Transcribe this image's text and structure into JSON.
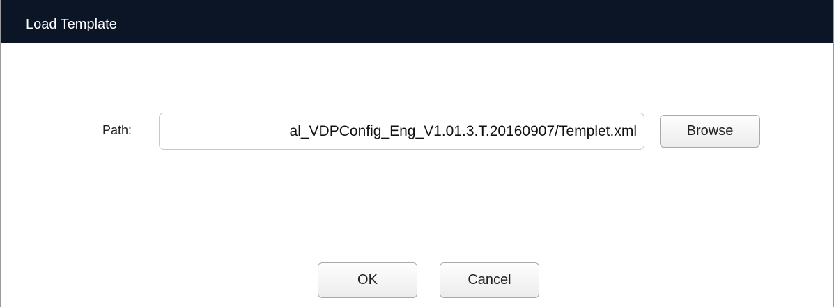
{
  "dialog": {
    "title": "Load Template"
  },
  "path": {
    "label": "Path:",
    "value": "al_VDPConfig_Eng_V1.01.3.T.20160907/Templet.xml"
  },
  "buttons": {
    "browse_label": "Browse",
    "ok_label": "OK",
    "cancel_label": "Cancel"
  },
  "colors": {
    "titlebar_bg": "#0b1526",
    "title_text": "#ffffff"
  }
}
